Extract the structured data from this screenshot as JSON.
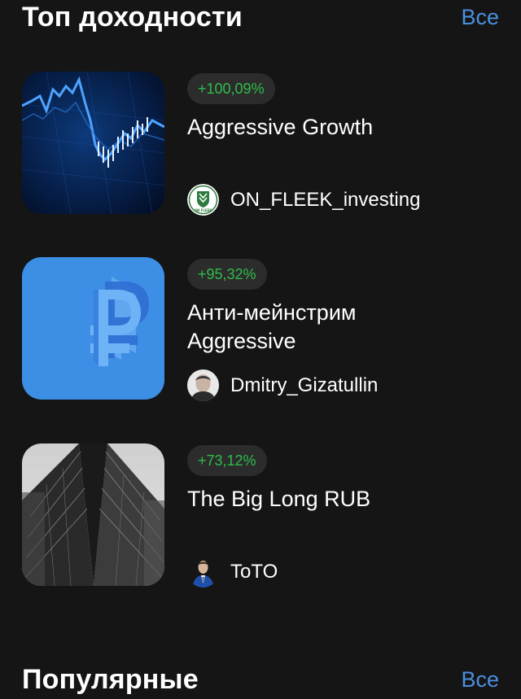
{
  "top_yield": {
    "title": "Топ доходности",
    "see_all": "Все",
    "cards": [
      {
        "badge": "+100,09%",
        "title": "Aggressive Growth",
        "author": "ON_FLEEK_investing",
        "image_icon": "stock-chart-image",
        "avatar_icon": "on-fleek-logo-icon",
        "avatar_label": "ON FLEEK"
      },
      {
        "badge": "+95,32%",
        "title": "Анти-мейнстрим Aggressive",
        "author": "Dmitry_Gizatullin",
        "image_icon": "ruble-symbol-image",
        "avatar_icon": "user-photo-avatar"
      },
      {
        "badge": "+73,12%",
        "title": "The Big Long RUB",
        "author": "ToTO",
        "image_icon": "skyscraper-image",
        "avatar_icon": "user-photo-avatar"
      }
    ]
  },
  "popular": {
    "title": "Популярные",
    "see_all": "Все"
  },
  "colors": {
    "background": "#151515",
    "accent_link": "#4a8fe0",
    "positive": "#2fbd4a",
    "badge_bg": "#2c2c2c",
    "card2_bg": "#3d8fe6"
  }
}
